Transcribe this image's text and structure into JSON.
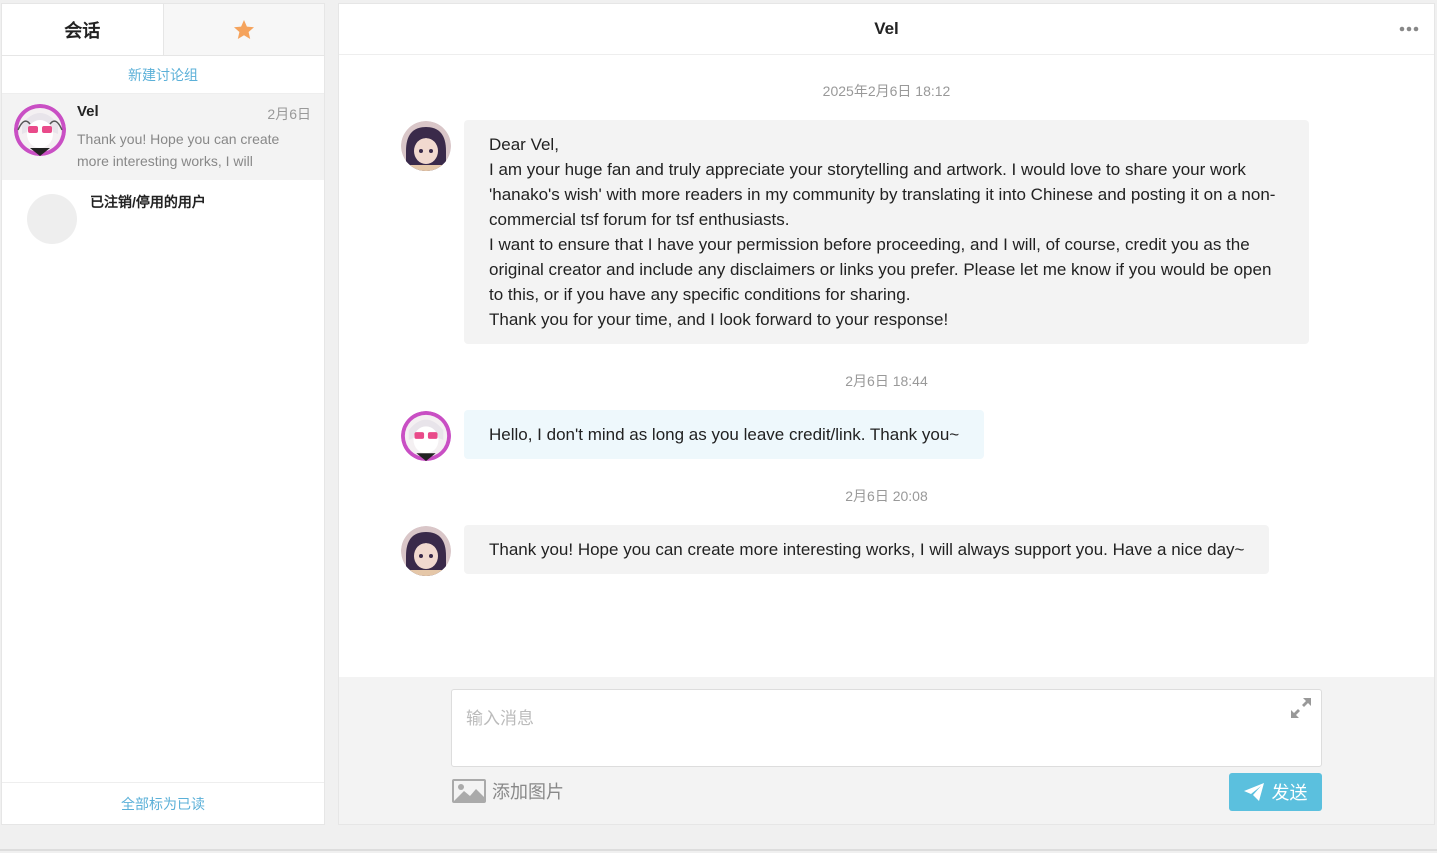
{
  "left": {
    "tabs": {
      "conversations": "会话",
      "favorites_icon": "star-icon"
    },
    "new_group": "新建讨论组",
    "conversations": [
      {
        "name": "Vel",
        "date": "2月6日",
        "preview": "Thank you! Hope you can create more interesting works, I will"
      },
      {
        "name": "已注销/停用的用户"
      }
    ],
    "mark_all_read": "全部标为已读"
  },
  "chat": {
    "title": "Vel",
    "messages": [
      {
        "time": "2025年2月6日 18:12",
        "lines": [
          "Dear Vel,",
          "I am your huge fan and truly appreciate your storytelling and artwork. I would love to share your work 'hanako's wish' with more readers in my community by translating it into Chinese and posting it on a non-commercial tsf forum for tsf enthusiasts.",
          "I want to ensure that I have your permission before proceeding, and I will, of course, credit you as the original creator and include any disclaimers or links you prefer. Please let me know if you would be open to this, or if you have any specific conditions for sharing.",
          "Thank you for your time, and I look forward to your response!"
        ]
      },
      {
        "time": "2月6日 18:44",
        "text": "Hello, I don't mind as long as you leave credit/link. Thank you~"
      },
      {
        "time": "2月6日 20:08",
        "text": "Thank you! Hope you can create more interesting works, I will always support you. Have a nice day~"
      }
    ]
  },
  "input": {
    "placeholder": "输入消息",
    "add_image": "添加图片",
    "send": "发送"
  },
  "colors": {
    "accent": "#5bc0de",
    "link": "#5bb0d8",
    "star": "#f5a35c"
  }
}
